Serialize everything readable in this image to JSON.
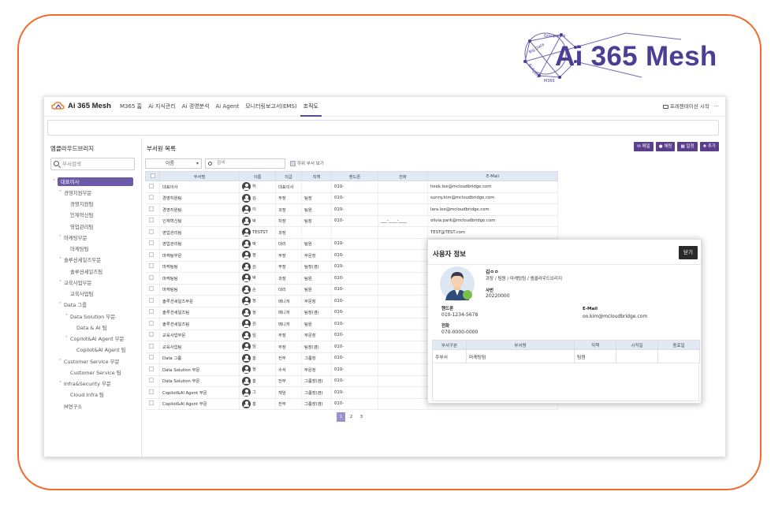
{
  "brand": {
    "name": "Ai 365 Mesh",
    "network_labels": [
      "Groupware",
      "Big Data",
      "Ai Agent",
      "M365"
    ]
  },
  "app": {
    "logo_text": "Ai 365 Mesh",
    "nav": [
      "M365 홈",
      "Ai 지식관리",
      "Ai 경영분석",
      "Ai Agent",
      "모니터링보고서(EMS)",
      "조직도"
    ],
    "active_nav": "조직도",
    "present_label": "프레젠테이션 시작",
    "more": "···"
  },
  "tree": {
    "title": "엠클라우드브리지",
    "search_placeholder": "부서검색",
    "items": [
      {
        "label": "대표이사",
        "level": 0,
        "chev": "˅",
        "selected": true
      },
      {
        "label": "경영지원부문",
        "level": 1,
        "chev": "˅"
      },
      {
        "label": "경영지원팀",
        "level": 2,
        "chev": ""
      },
      {
        "label": "인재혁신팀",
        "level": 2,
        "chev": ""
      },
      {
        "label": "영업관리팀",
        "level": 2,
        "chev": ""
      },
      {
        "label": "마케팅부문",
        "level": 1,
        "chev": "˅"
      },
      {
        "label": "마케팅팀",
        "level": 2,
        "chev": ""
      },
      {
        "label": "솔루션세일즈부문",
        "level": 1,
        "chev": "˅"
      },
      {
        "label": "솔루션세일즈팀",
        "level": 2,
        "chev": ""
      },
      {
        "label": "교육사업부문",
        "level": 1,
        "chev": "˅"
      },
      {
        "label": "교육사업팀",
        "level": 2,
        "chev": ""
      },
      {
        "label": "Data 그룹",
        "level": 1,
        "chev": "˅"
      },
      {
        "label": "Data Solution 부문",
        "level": 2,
        "chev": "˅"
      },
      {
        "label": "Data & AI 팀",
        "level": 3,
        "chev": ""
      },
      {
        "label": "Copilot&AI Agent 부문",
        "level": 2,
        "chev": "˅"
      },
      {
        "label": "Copilot&AI Agent 팀",
        "level": 3,
        "chev": ""
      },
      {
        "label": "Customer Service 부문",
        "level": 1,
        "chev": "˅"
      },
      {
        "label": "Customer Service 팀",
        "level": 2,
        "chev": ""
      },
      {
        "label": "Infra&Security 부문",
        "level": 1,
        "chev": "˅"
      },
      {
        "label": "Cloud Infra 팀",
        "level": 2,
        "chev": ""
      },
      {
        "label": "M연구소",
        "level": 1,
        "chev": ""
      }
    ]
  },
  "main": {
    "title": "부서원 목록",
    "actions": [
      "메일",
      "채팅",
      "일정",
      "추가"
    ],
    "filter_select": "이름",
    "search_placeholder": "검색",
    "subdept_label": "하위 부서 보기",
    "columns": [
      "",
      "부서명",
      "이름",
      "직급",
      "직책",
      "핸드폰",
      "전화",
      "E-Mail"
    ],
    "rows": [
      [
        "대표이사",
        "허",
        "대표이사",
        "",
        "010-",
        "",
        "heek.lee@mcloudbridge.com"
      ],
      [
        "경영지원팀",
        "김",
        "부장",
        "팀장",
        "010-",
        "",
        "sunny.kim@mcloudbridge.com"
      ],
      [
        "경영지원팀",
        "이",
        "과장",
        "팀원",
        "010-",
        "",
        "lara.lee@mcloudbridge.com"
      ],
      [
        "인재혁신팀",
        "박",
        "차장",
        "팀장",
        "010-",
        "___-____-____",
        "olivia.park@mcloudbridge.com"
      ],
      [
        "영업관리팀",
        "TESTST",
        "과장",
        "",
        "",
        "",
        "TEST@TEST.com"
      ],
      [
        "영업관리팀",
        "박",
        "대리",
        "팀원",
        "010-",
        "",
        ""
      ],
      [
        "마케팅부문",
        "정",
        "부장",
        "부문장",
        "010-",
        "",
        ""
      ],
      [
        "마케팅팀",
        "김",
        "부장",
        "팀장(겸)",
        "010-",
        "",
        ""
      ],
      [
        "마케팅팀",
        "박",
        "과장",
        "팀원",
        "010-",
        "",
        ""
      ],
      [
        "마케팅팀",
        "손",
        "대리",
        "팀원",
        "010-",
        "",
        ""
      ],
      [
        "솔루션세일즈부문",
        "정",
        "매니저",
        "부문장",
        "010-",
        "",
        ""
      ],
      [
        "솔루션세일즈팀",
        "정",
        "매니저",
        "팀장(겸)",
        "010-",
        "",
        ""
      ],
      [
        "솔루션세일즈팀",
        "김",
        "매니저",
        "팀원",
        "010-",
        "",
        ""
      ],
      [
        "교육사업부문",
        "임",
        "부장",
        "부문장",
        "010-",
        "",
        ""
      ],
      [
        "교육사업팀",
        "임",
        "부장",
        "팀장(겸)",
        "010-",
        "",
        ""
      ],
      [
        "Data 그룹",
        "홍",
        "전무",
        "그룹장",
        "010-",
        "",
        ""
      ],
      [
        "Data Solution 부문",
        "정",
        "수석",
        "부문장",
        "010-",
        "",
        ""
      ],
      [
        "Data Solution 부문",
        "홍",
        "전무",
        "그룹장(겸)",
        "010-",
        "",
        ""
      ],
      [
        "Copilot&AI Agent 부문",
        "그",
        "책임",
        "그룹장(겸)",
        "010-",
        "",
        ""
      ],
      [
        "Copilot&AI Agent 부문",
        "홍",
        "전무",
        "그룹장(겸)",
        "010-",
        "",
        ""
      ]
    ],
    "pages": [
      "1",
      "2",
      "3"
    ],
    "current_page": "1"
  },
  "modal": {
    "title": "사용자 정보",
    "close_label": "닫기",
    "name": "김ㅇㅇ",
    "path": "과장 / 팀원 / 마케팅팀 / 엠클라우드브리지",
    "emp_label": "사번",
    "emp_value": "20220000",
    "mobile_label": "핸드폰",
    "mobile_value": "010-1234-5678",
    "email_label": "E-Mail",
    "email_value": "oo.kim@mcloudbridge.com",
    "phone_label": "전화",
    "phone_value": "070-0000-0000",
    "table_columns": [
      "부서구분",
      "부서명",
      "직책",
      "시작일",
      "종료일"
    ],
    "table_row": [
      "주부서",
      "마케팅팀",
      "팀원",
      "",
      ""
    ],
    "colors": {
      "accent": "#5b3e8c",
      "frame": "#f06a2a",
      "brand": "#4a3f95"
    }
  }
}
